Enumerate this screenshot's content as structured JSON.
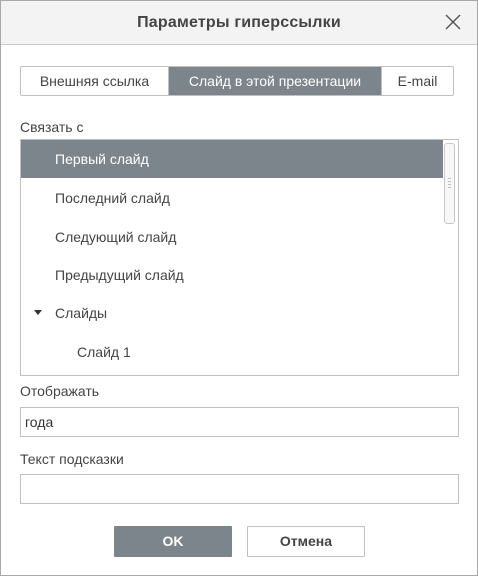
{
  "dialog": {
    "title": "Параметры гиперссылки"
  },
  "tabs": [
    {
      "label": "Внешняя ссылка",
      "active": false
    },
    {
      "label": "Слайд в этой презентации",
      "active": true
    },
    {
      "label": "E-mail",
      "active": false
    }
  ],
  "link_to": {
    "label": "Связать с",
    "items": [
      {
        "label": "Первый слайд",
        "selected": true
      },
      {
        "label": "Последний слайд",
        "selected": false
      },
      {
        "label": "Следующий слайд",
        "selected": false
      },
      {
        "label": "Предыдущий слайд",
        "selected": false
      },
      {
        "label": "Слайды",
        "selected": false,
        "expanded": true,
        "icon": "caret-down-icon"
      },
      {
        "label": "Слайд 1",
        "selected": false
      }
    ]
  },
  "display": {
    "label": "Отображать",
    "value": "года"
  },
  "tooltip": {
    "label": "Текст подсказки",
    "value": ""
  },
  "buttons": {
    "ok": "OK",
    "cancel": "Отмена"
  },
  "colors": {
    "accent": "#7d858c",
    "titlebar": "#f3f3f3",
    "border": "#c0c0c0"
  }
}
